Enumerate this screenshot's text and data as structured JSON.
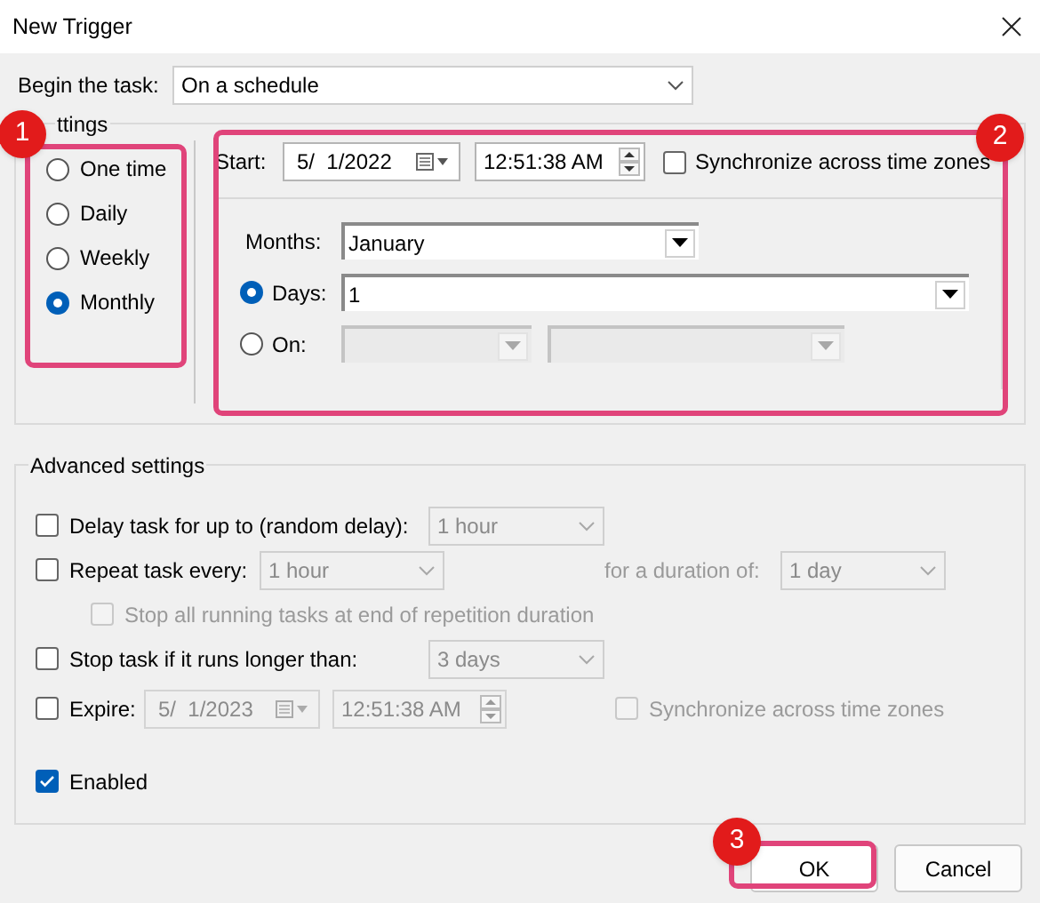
{
  "window": {
    "title": "New Trigger"
  },
  "begin": {
    "label": "Begin the task:",
    "value": "On a schedule"
  },
  "settings": {
    "legend": "ttings",
    "schedules": [
      {
        "label": "One time",
        "selected": false
      },
      {
        "label": "Daily",
        "selected": false
      },
      {
        "label": "Weekly",
        "selected": false
      },
      {
        "label": "Monthly",
        "selected": true
      }
    ],
    "start": {
      "label": "Start:",
      "date": "5/  1/2022",
      "time": "12:51:38 AM"
    },
    "sync": {
      "label": "Synchronize across time zones",
      "checked": false
    },
    "months": {
      "label": "Months:",
      "value": "January"
    },
    "days": {
      "label": "Days:",
      "value": "1",
      "selected": true
    },
    "on": {
      "label": "On:",
      "selected": false
    }
  },
  "advanced": {
    "legend": "Advanced settings",
    "delay": {
      "label": "Delay task for up to (random delay):",
      "checked": false,
      "value": "1 hour",
      "disabled": true
    },
    "repeat": {
      "label": "Repeat task every:",
      "checked": false,
      "value": "1 hour",
      "duration_label": "for a duration of:",
      "duration_value": "1 day",
      "disabled": true
    },
    "stop_all": {
      "label": "Stop all running tasks at end of repetition duration",
      "checked": false,
      "disabled": true
    },
    "stop_task": {
      "label": "Stop task if it runs longer than:",
      "checked": false,
      "value": "3 days",
      "disabled": true
    },
    "expire": {
      "label": "Expire:",
      "checked": false,
      "date": "5/  1/2023",
      "time": "12:51:38 AM",
      "disabled": true,
      "sync": {
        "label": "Synchronize across time zones",
        "checked": false,
        "disabled": true
      }
    },
    "enabled": {
      "label": "Enabled",
      "checked": true
    }
  },
  "buttons": [
    {
      "label": "OK"
    },
    {
      "label": "Cancel"
    }
  ],
  "callouts": [
    {
      "number": "1"
    },
    {
      "number": "2"
    },
    {
      "number": "3"
    }
  ]
}
